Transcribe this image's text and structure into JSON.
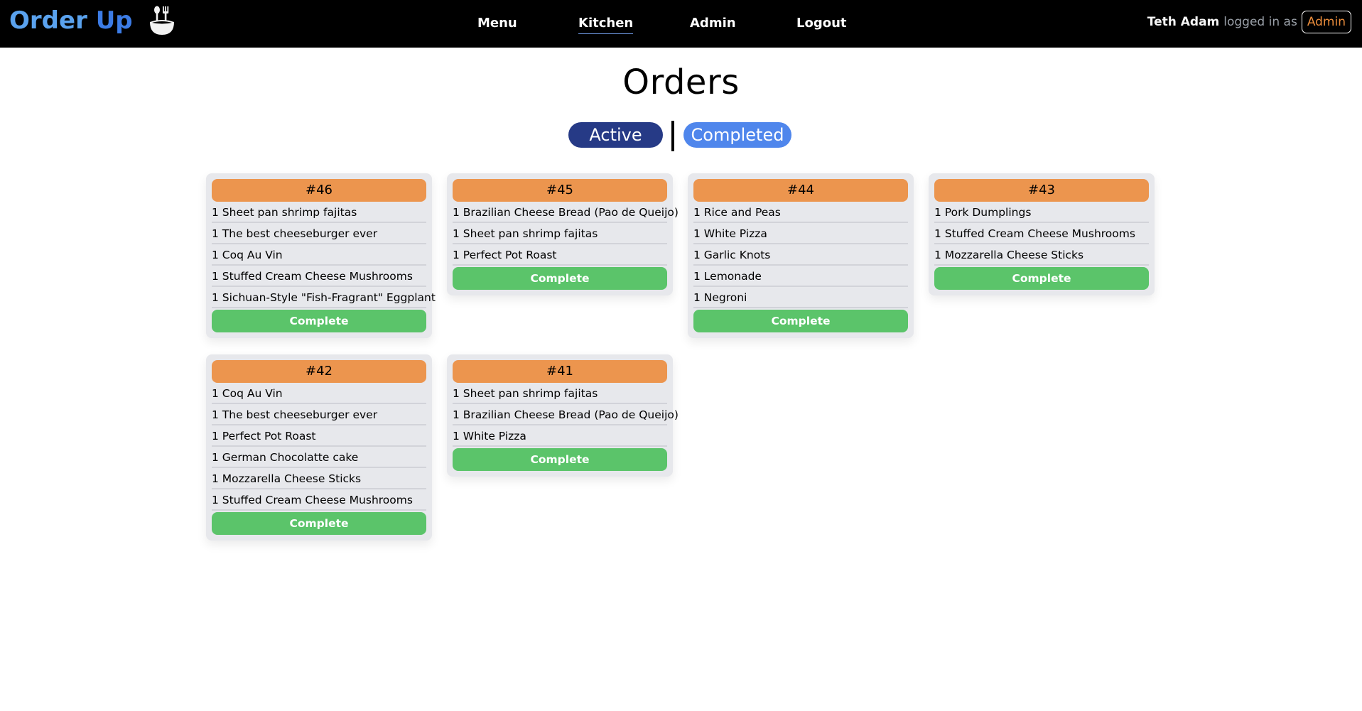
{
  "navbar": {
    "brand": {
      "word1": "Order",
      "word2": "Up",
      "icon": "bowl-with-utensils-icon"
    },
    "links": [
      {
        "label": "Menu",
        "active": false
      },
      {
        "label": "Kitchen",
        "active": true
      },
      {
        "label": "Admin",
        "active": false
      },
      {
        "label": "Logout",
        "active": false
      }
    ],
    "user": {
      "name": "Teth Adam",
      "text": "logged in as",
      "role": "Admin"
    }
  },
  "page": {
    "title": "Orders",
    "tabs": [
      {
        "label": "Active",
        "selected": true
      },
      {
        "label": "Completed",
        "selected": false
      }
    ]
  },
  "colors": {
    "navbar_bg": "#000000",
    "brand_blue_light": "#5aa2ee",
    "brand_blue": "#3c7ce6",
    "tab_active": "#263a86",
    "tab_completed": "#4f86ec",
    "order_header": "#ec954e",
    "complete_button": "#5bc46a",
    "role_badge_text": "#eb8d3c",
    "card_bg": "#e7e8ec"
  },
  "orders": [
    {
      "number": "#46",
      "items": [
        "1 Sheet pan shrimp fajitas",
        "1 The best cheeseburger ever",
        "1 Coq Au Vin",
        "1 Stuffed Cream Cheese Mushrooms",
        "1 Sichuan-Style \"Fish-Fragrant\" Eggplant"
      ],
      "button": "Complete"
    },
    {
      "number": "#45",
      "items": [
        "1 Brazilian Cheese Bread (Pao de Queijo)",
        "1 Sheet pan shrimp fajitas",
        "1 Perfect Pot Roast"
      ],
      "button": "Complete"
    },
    {
      "number": "#44",
      "items": [
        "1 Rice and Peas",
        "1 White Pizza",
        "1 Garlic Knots",
        "1 Lemonade",
        "1 Negroni"
      ],
      "button": "Complete"
    },
    {
      "number": "#43",
      "items": [
        "1 Pork Dumplings",
        "1 Stuffed Cream Cheese Mushrooms",
        "1 Mozzarella Cheese Sticks"
      ],
      "button": "Complete"
    },
    {
      "number": "#42",
      "items": [
        "1 Coq Au Vin",
        "1 The best cheeseburger ever",
        "1 Perfect Pot Roast",
        "1 German Chocolatte cake",
        "1 Mozzarella Cheese Sticks",
        "1 Stuffed Cream Cheese Mushrooms"
      ],
      "button": "Complete"
    },
    {
      "number": "#41",
      "items": [
        "1 Sheet pan shrimp fajitas",
        "1 Brazilian Cheese Bread (Pao de Queijo)",
        "1 White Pizza"
      ],
      "button": "Complete"
    }
  ]
}
